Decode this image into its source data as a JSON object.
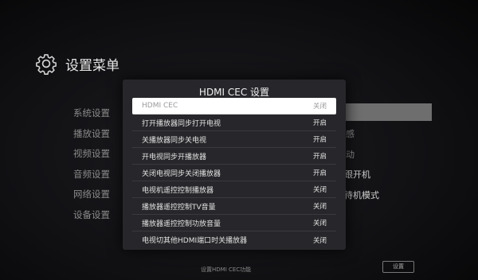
{
  "settings": {
    "title": "设置菜单",
    "menu": [
      "系统设置",
      "播放设置",
      "视频设置",
      "音频设置",
      "网络设置",
      "设备设置"
    ],
    "right_partial": [
      "感",
      "动",
      "跟开机",
      "待机模式"
    ],
    "footer_hint": "设置HDMI CEC功能",
    "footer_button": "设置"
  },
  "dialog": {
    "title": "HDMI CEC 设置",
    "options": [
      {
        "label": "HDMI CEC",
        "value": "关闭",
        "selected": true
      },
      {
        "label": "打开播放器同步打开电视",
        "value": "开启"
      },
      {
        "label": "关播放器同步关电视",
        "value": "开启"
      },
      {
        "label": "开电视同步开播放器",
        "value": "开启"
      },
      {
        "label": "关闭电视同步关闭播放器",
        "value": "开启"
      },
      {
        "label": "电视机遥控控制播放器",
        "value": "关闭"
      },
      {
        "label": "播放器遥控控制TV音量",
        "value": "关闭"
      },
      {
        "label": "播放器遥控控制功放音量",
        "value": "关闭"
      },
      {
        "label": "电视切其他HDMI端口时关播放器",
        "value": "关闭"
      }
    ]
  },
  "colors": {
    "dialog_bg": "#27272b",
    "selected_row_bg": "#ffffff",
    "background_highlight": "#6e6e6e"
  },
  "icons": [
    "gear-icon"
  ]
}
